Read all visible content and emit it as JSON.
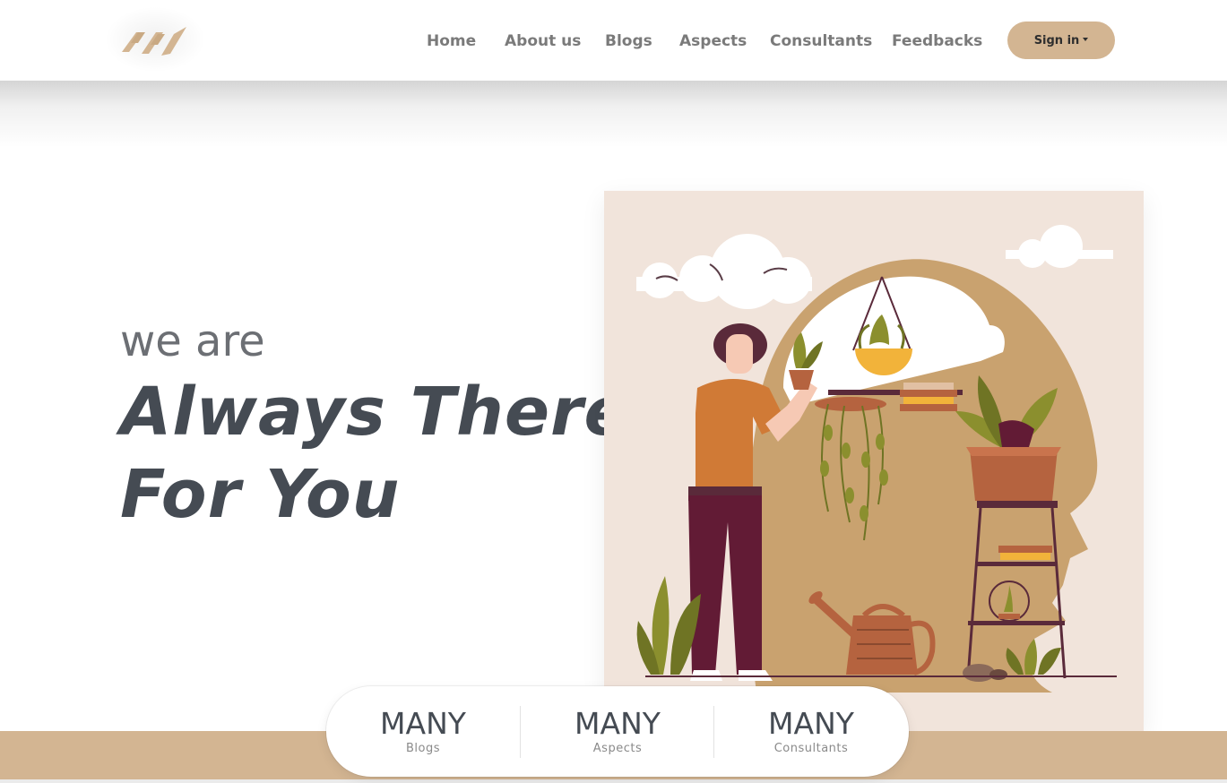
{
  "nav": {
    "links": [
      "Home",
      "About us",
      "Blogs",
      "Aspects",
      "Consultants",
      "Feedbacks"
    ],
    "signin_label": "Sign in"
  },
  "hero": {
    "subtitle": "we are",
    "title_line1": "Always There",
    "title_line2": "For You"
  },
  "stats": [
    {
      "value": "MANY",
      "label": "Blogs"
    },
    {
      "value": "MANY",
      "label": "Aspects"
    },
    {
      "value": "MANY",
      "label": "Consultants"
    }
  ],
  "colors": {
    "brand_tan": "#d3b592",
    "text_dark": "#454b53",
    "text_muted": "#6c6f74",
    "nav_text": "#7a7a7a",
    "illustration_bg": "#f1e4db"
  }
}
